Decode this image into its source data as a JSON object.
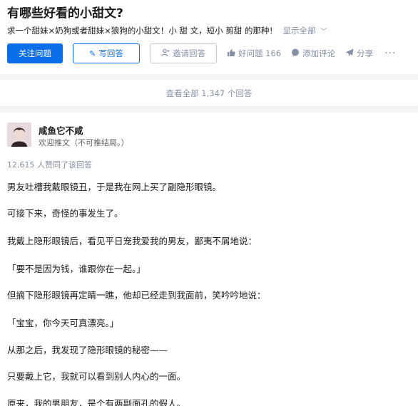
{
  "question": {
    "title": "有哪些好看的小甜文?",
    "description": "求一个甜妹×奶狗或者甜妹×狼狗的小甜文！小 甜 文，短小 剪甜 的那种！",
    "show_all_label": "显示全部",
    "follow_label": "关注问题",
    "write_answer_label": "写回答",
    "invite_label": "邀请回答",
    "good_question_label": "好问题 166",
    "comment_label": "添加评论",
    "share_label": "分享",
    "more_label": "···"
  },
  "view_all_answers": "查看全部 1,347 个回答",
  "answer": {
    "author_name": "咸鱼它不咸",
    "author_bio": "欢迎推文（不可推结局。）",
    "vote_text": "12,615 人赞同了该回答",
    "paragraphs": [
      "男友吐槽我戴眼镜丑，于是我在网上买了副隐形眼镜。",
      "可接下来，奇怪的事发生了。",
      "我戴上隐形眼镜后，看见平日宠我爱我的男友，鄙夷不屑地说：",
      "「要不是因为钱，谁跟你在一起。」",
      "但摘下隐形眼镜再定睛一瞧，他却已经走到我面前，笑吟吟地说：",
      "「宝宝，你今天可真漂亮。」",
      "从那之后，我发现了隐形眼镜的秘密——",
      "只要戴上它，我就可以看到别人内心的一面。",
      "原来，我的男朋友，是个有两副面孔的假人。"
    ]
  },
  "icons": {
    "write": "pencil-icon",
    "invite": "person-plus-icon",
    "good_question": "thumbs-up-icon",
    "comment": "speech-bubble-icon",
    "share": "paper-plane-icon",
    "show_all": "chevron-down-icon"
  },
  "colors": {
    "brand_blue": "#0a6ee8",
    "meta_gray": "#8590a6",
    "page_gap": "#f4f4f6"
  }
}
